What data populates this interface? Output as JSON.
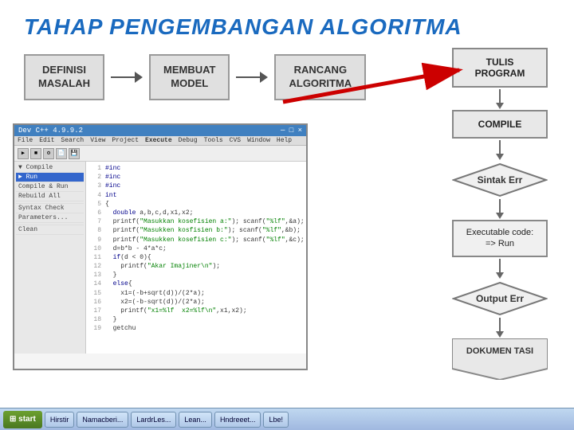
{
  "title": "TAHAP PENGEMBANGAN ALGORITMA",
  "flow": {
    "step1": "DEFINISI\nMASALAH",
    "step2": "MEMBUAT\nMODEL",
    "step3": "RANCANG\nALGORITMA",
    "step4_label": "TULIS PROGRAM"
  },
  "steps_panel": {
    "tulis_program": "TULIS PROGRAM",
    "compile": "COMPILE",
    "sintak_err": "Sintak Err",
    "executable": "Executable code:\n=> Run",
    "output_err": "Output Err",
    "dokumen_tasi": "DOKUMEN TASI"
  },
  "editor": {
    "titlebar": "Dev C++ 4.9.9.2",
    "menu": [
      "File",
      "Edit",
      "Search",
      "View",
      "Project",
      "Execute",
      "Debug",
      "Tools",
      "CVS",
      "Window",
      "Help"
    ],
    "dropdown_items": [
      "Compile",
      "Run",
      "Compile & Run",
      "Rebuild All",
      "---",
      "Syntax Check",
      "Parameters...",
      "---",
      "Clean"
    ],
    "code_lines": [
      {
        "num": "1",
        "text": "#inc"
      },
      {
        "num": "2",
        "text": "#inc"
      },
      {
        "num": "3",
        "text": "#inc"
      },
      {
        "num": "4",
        "text": "int"
      },
      {
        "num": "5",
        "text": "{"
      },
      {
        "num": "6",
        "text": "   double a,b,c,d,x1,x2;"
      },
      {
        "num": "7",
        "text": "   printf(\"Masukkan koefisien a:\"); scanf(\"%lf\",&a);"
      },
      {
        "num": "8",
        "text": "   printf(\"Masukken koefisien b:\"); scanf(\"%lf\",&b);"
      },
      {
        "num": "9",
        "text": "   printf(\"Masukken koefisien c:\"); scanf(\"%lf\",&c);"
      },
      {
        "num": "10",
        "text": "   d=b*b - 4*a*c;"
      },
      {
        "num": "11",
        "text": "   if(d < 0){"
      },
      {
        "num": "12",
        "text": "      printf(\"Akar Imajiner\\n\");"
      },
      {
        "num": "13",
        "text": "   }"
      },
      {
        "num": "14",
        "text": "   else{"
      },
      {
        "num": "15",
        "text": "      x1=(-b+sqrt(d))/(2*a);"
      },
      {
        "num": "16",
        "text": "      x2=(-b-sqrt(d))/(2*a);"
      },
      {
        "num": "17",
        "text": "      printf(\"x1=%lf  x2=%lf\\n\",x1,x2);"
      },
      {
        "num": "18",
        "text": "   }"
      },
      {
        "num": "19",
        "text": "   getchu"
      }
    ]
  },
  "taskbar": {
    "start": "start",
    "items": [
      "Hirstir",
      "Namacberi...",
      "LardrLes...",
      "Lean...",
      "Hndreeet...",
      "Lbe!"
    ]
  },
  "colors": {
    "title": "#1a6abf",
    "box_bg": "#e0e0e0",
    "box_border": "#999",
    "red_arrow": "#cc0000",
    "diamond_bg": "#f0f0f0"
  }
}
